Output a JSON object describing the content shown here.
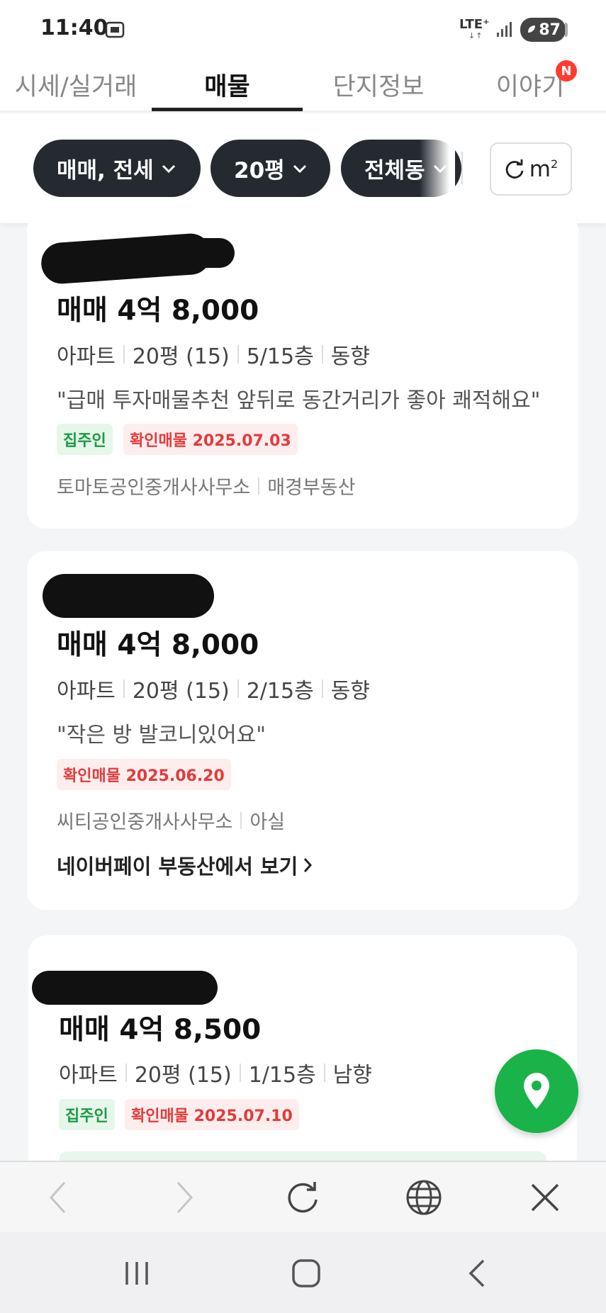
{
  "status_bar": {
    "time": "11:40",
    "network": "LTE⁺",
    "network_arrows": "↓↑",
    "battery": "87"
  },
  "tabs": [
    {
      "label": "시세/실거래",
      "active": false
    },
    {
      "label": "매물",
      "active": true
    },
    {
      "label": "단지정보",
      "active": false
    },
    {
      "label": "이야기",
      "active": false,
      "badge": "N"
    }
  ],
  "filters": {
    "chips": [
      "매매, 전세",
      "20평",
      "전체동"
    ],
    "unit_label": "m",
    "unit_sup": "2"
  },
  "listings": [
    {
      "price": "매매 4억 8,000",
      "specs": [
        "아파트",
        "20평 (15)",
        "5/15층",
        "동향"
      ],
      "quote": "\"급매 투자매물추천 앞뒤로 동간거리가 좋아 쾌적해요\"",
      "tags": [
        {
          "label": "집주인",
          "kind": "owner"
        },
        {
          "label": "확인매물 2025.07.03",
          "kind": "confirm"
        }
      ],
      "agency": [
        "토마토공인중개사사무소",
        "매경부동산"
      ]
    },
    {
      "price": "매매 4억 8,000",
      "specs": [
        "아파트",
        "20평 (15)",
        "2/15층",
        "동향"
      ],
      "quote": "\"작은 방 발코니있어요\"",
      "tags": [
        {
          "label": "확인매물 2025.06.20",
          "kind": "confirm"
        }
      ],
      "agency": [
        "씨티공인중개사사무소",
        "아실"
      ],
      "link": "네이버페이 부동산에서 보기"
    },
    {
      "price": "매매 4억 8,500",
      "specs": [
        "아파트",
        "20평 (15)",
        "1/15층",
        "남향"
      ],
      "tags": [
        {
          "label": "집주인",
          "kind": "owner"
        },
        {
          "label": "확인매물 2025.07.10",
          "kind": "confirm"
        }
      ]
    }
  ],
  "colors": {
    "chip_bg": "#252a31",
    "owner_tag": "#1b9a43",
    "confirm_tag": "#e23b3b",
    "map_button": "#19b349",
    "badge": "#ff3b30"
  },
  "icons": {
    "map_button": "location-pin-icon",
    "browser": [
      "back-icon",
      "forward-icon",
      "reload-icon",
      "globe-icon",
      "close-icon"
    ],
    "nav": [
      "recents-icon",
      "home-icon",
      "nav-back-icon"
    ]
  }
}
